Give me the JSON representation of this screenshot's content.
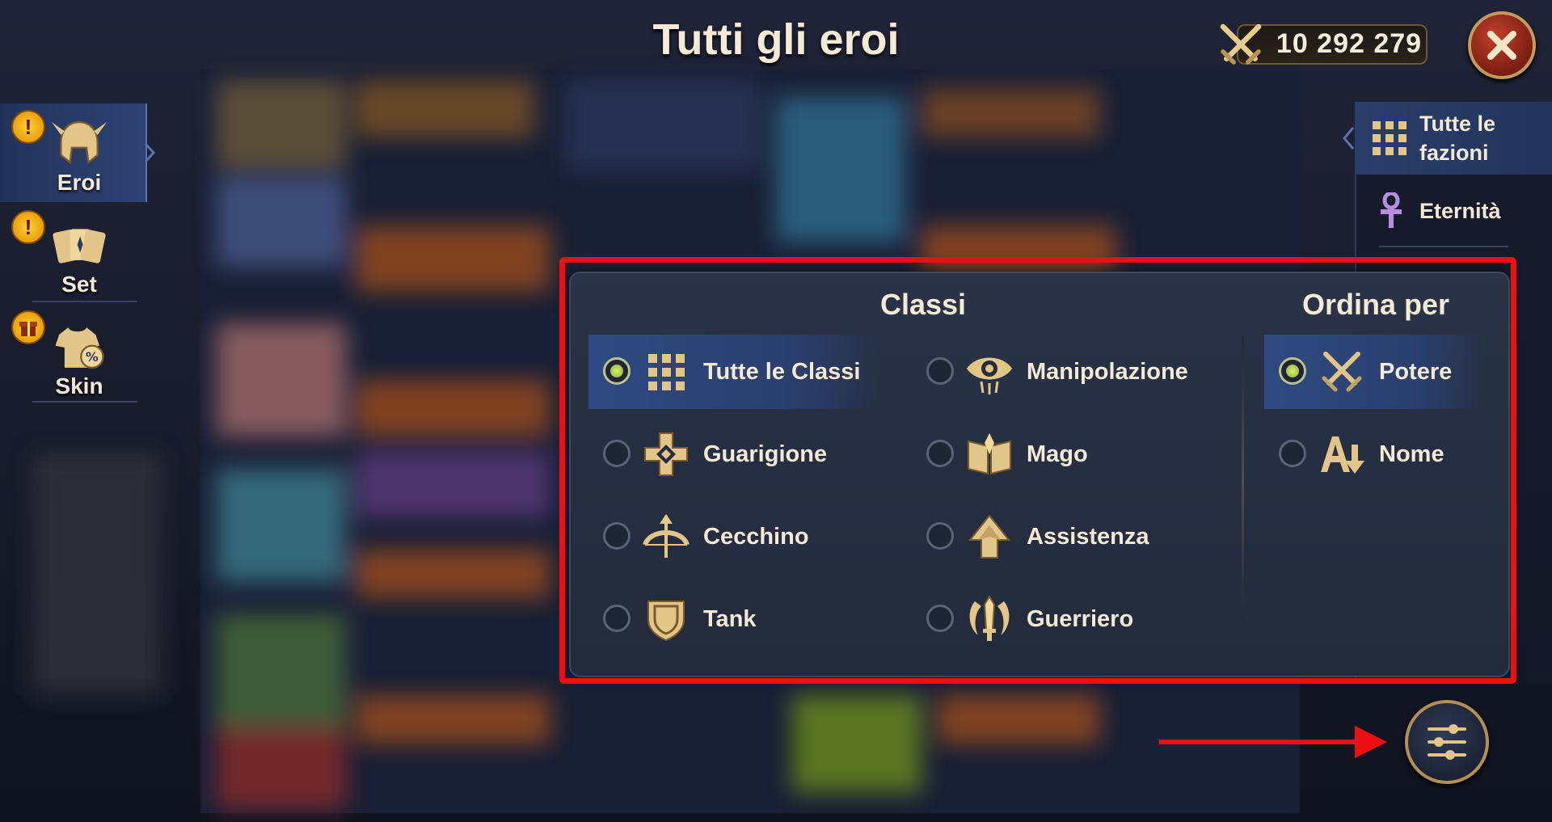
{
  "header": {
    "title": "Tutti gli eroi",
    "power_value": "10 292 279",
    "power_icon": "crossed-swords-icon",
    "close_icon": "close-icon"
  },
  "left_sidebar": {
    "items": [
      {
        "label": "Eroi",
        "icon": "helmet-icon",
        "badge": "!",
        "active": true
      },
      {
        "label": "Set",
        "icon": "cards-icon",
        "badge": "!",
        "active": false
      },
      {
        "label": "Skin",
        "icon": "shirt-icon",
        "badge": "gift",
        "active": false
      }
    ]
  },
  "factions": {
    "items": [
      {
        "label": "Tutte le fazioni",
        "line1": "Tutte le",
        "line2": "fazioni",
        "icon": "grid-icon",
        "active": true
      },
      {
        "label": "Eternità",
        "icon": "ankh-icon",
        "active": false
      }
    ]
  },
  "filter_panel": {
    "classes_title": "Classi",
    "sort_title": "Ordina per",
    "classes": [
      {
        "label": "Tutte le Classi",
        "icon": "grid-icon",
        "selected": true
      },
      {
        "label": "Manipolazione",
        "icon": "eye-icon",
        "selected": false
      },
      {
        "label": "Guarigione",
        "icon": "healing-cross-icon",
        "selected": false
      },
      {
        "label": "Mago",
        "icon": "spellbook-icon",
        "selected": false
      },
      {
        "label": "Cecchino",
        "icon": "bow-icon",
        "selected": false
      },
      {
        "label": "Assistenza",
        "icon": "up-arrow-icon",
        "selected": false
      },
      {
        "label": "Tank",
        "icon": "shield-icon",
        "selected": false
      },
      {
        "label": "Guerriero",
        "icon": "sword-icon",
        "selected": false
      }
    ],
    "sort_options": [
      {
        "label": "Potere",
        "icon": "crossed-swords-icon",
        "selected": true
      },
      {
        "label": "Nome",
        "icon": "alphabet-sort-icon",
        "selected": false
      }
    ]
  },
  "filter_button": {
    "icon": "sliders-icon"
  },
  "colors": {
    "highlight": "#ee0f14",
    "selected_row": "#2f4a82",
    "gold": "#e2c589",
    "panel": "#252d3f",
    "badge": "#ffc21e"
  }
}
